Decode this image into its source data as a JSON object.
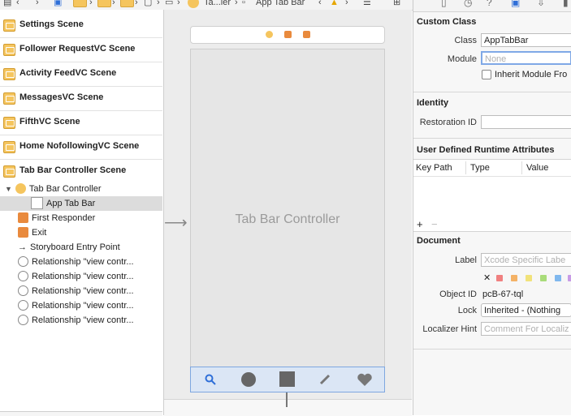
{
  "jumpbar": {
    "crumb_tab": "Ta...ler",
    "crumb_item": "App Tab Bar"
  },
  "outline": {
    "scenes": [
      "Settings Scene",
      "Follower RequestVC Scene",
      "Activity FeedVC Scene",
      "MessagesVC Scene",
      "FifthVC Scene",
      "Home NofollowingVC Scene",
      "Tab Bar Controller Scene"
    ],
    "controller": "Tab Bar Controller",
    "tab_bar_item": "App Tab Bar",
    "first_responder": "First Responder",
    "exit": "Exit",
    "entry_point": "Storyboard Entry Point",
    "relationships": [
      "Relationship \"view contr...",
      "Relationship \"view contr...",
      "Relationship \"view contr...",
      "Relationship \"view contr...",
      "Relationship \"view contr..."
    ]
  },
  "canvas": {
    "title": "Tab Bar Controller"
  },
  "inspector": {
    "custom_class": {
      "title": "Custom Class",
      "class_label": "Class",
      "class_value": "AppTabBar",
      "module_label": "Module",
      "module_placeholder": "None",
      "inherit_label": "Inherit Module Fro"
    },
    "identity": {
      "title": "Identity",
      "restoration_label": "Restoration ID"
    },
    "runtime": {
      "title": "User Defined Runtime Attributes",
      "columns": [
        "Key Path",
        "Type",
        "Value"
      ]
    },
    "document": {
      "title": "Document",
      "label_label": "Label",
      "label_placeholder": "Xcode Specific Labe",
      "object_id_label": "Object ID",
      "object_id_value": "pcB-67-tql",
      "lock_label": "Lock",
      "lock_value": "Inherited - (Nothing",
      "localizer_label": "Localizer Hint",
      "localizer_placeholder": "Comment For Localiz"
    }
  },
  "colors": {
    "accent": "#2f6fd8",
    "selection": "#dcdcdc",
    "folder": "#f5c55e"
  }
}
